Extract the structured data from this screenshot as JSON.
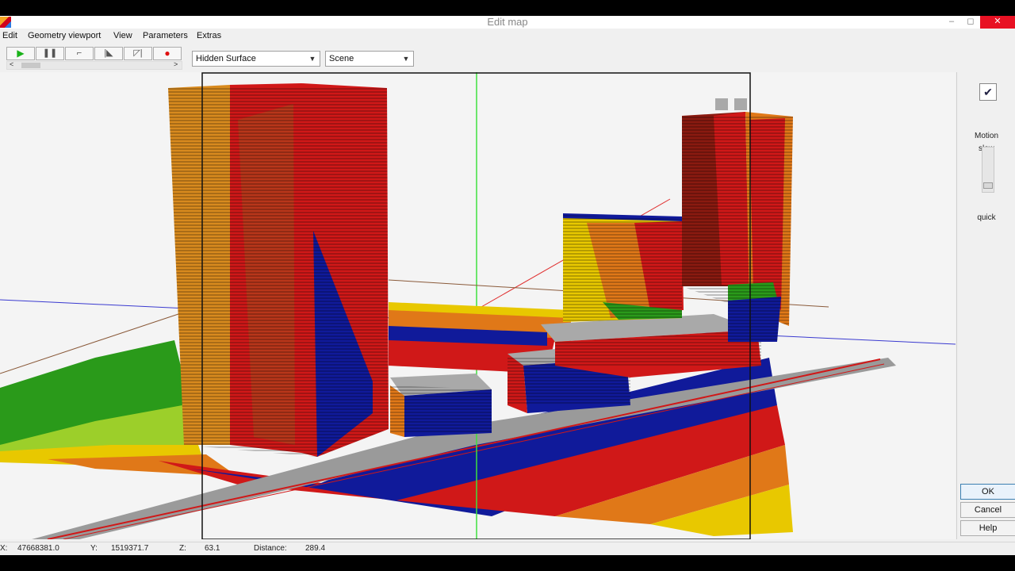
{
  "window": {
    "title": "Edit map"
  },
  "menu": [
    "Edit",
    "Geometry viewport",
    "View",
    "Parameters",
    "Extras"
  ],
  "toolbar": {
    "play_glyph": "▶",
    "pause_glyph": "❚❚",
    "step_glyph": "⌐",
    "frame_glyph": "|◣",
    "back_glyph": "◸|",
    "record_glyph": "●",
    "render_mode": "Hidden Surface",
    "scene": "Scene",
    "scroll_left": "<",
    "scroll_right": ">"
  },
  "side": {
    "motion_label": "Motion",
    "slow_label": "slow",
    "quick_label": "quick",
    "motion_level": 0.1,
    "ok": "OK",
    "cancel": "Cancel",
    "help": "Help"
  },
  "status": {
    "x_label": "X:",
    "x_value": "47668381.0",
    "y_label": "Y:",
    "y_value": "1519371.7",
    "z_label": "Z:",
    "z_value": "63.1",
    "distance_label": "Distance:",
    "distance_value": "289.4"
  },
  "icons": {
    "app": "app-icon",
    "motion": "motion-icon",
    "minimize": "minimize-icon",
    "maximize": "maximize-icon",
    "close": "close-icon"
  },
  "colors": {
    "level_yellow": "#e8c800",
    "level_orange": "#e07818",
    "level_red": "#d01818",
    "level_darkred": "#8a1a10",
    "level_blue": "#101a9a",
    "level_green": "#2a9a1a",
    "level_lightgreen": "#9ccf2a",
    "roof_gray": "#a9a9a9"
  }
}
